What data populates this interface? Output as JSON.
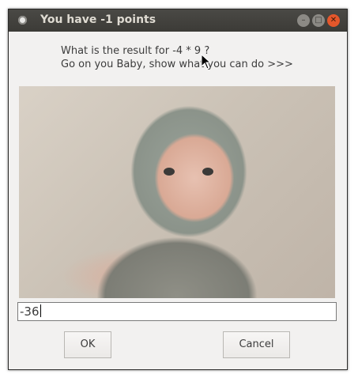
{
  "window": {
    "title": "You have -1 points",
    "controls": {
      "minimize": "minimize-icon",
      "maximize": "maximize-icon",
      "close": "close-icon"
    }
  },
  "prompt": {
    "line1": "What is the result for -4 * 9 ?",
    "line2": "Go on you Baby, show what you can do >>>"
  },
  "answer": {
    "value": "-36"
  },
  "buttons": {
    "ok": "OK",
    "cancel": "Cancel"
  },
  "colors": {
    "titlebar": "#3c3b37",
    "close_button": "#e5572b",
    "window_bg": "#f2f1f0"
  }
}
